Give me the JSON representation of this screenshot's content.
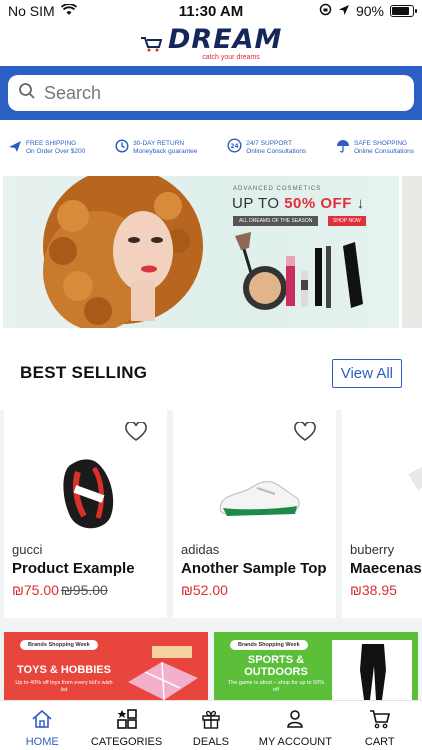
{
  "status": {
    "carrier": "No SIM",
    "time": "11:30 AM",
    "battery": "90%"
  },
  "brand": {
    "name": "DREAM",
    "tagline": "catch your dreams"
  },
  "search": {
    "placeholder": "Search"
  },
  "features": [
    {
      "icon": "plane-icon",
      "title": "FREE SHIPPING",
      "sub": "On Order Over $200"
    },
    {
      "icon": "clock-icon",
      "title": "30-DAY RETURN",
      "sub": "Moneyback guarantee"
    },
    {
      "icon": "support-24-icon",
      "title": "24/7 SUPPORT",
      "sub": "Online Consultations"
    },
    {
      "icon": "umbrella-icon",
      "title": "SAFE SHOPPING",
      "sub": "Online Consultations"
    }
  ],
  "banner": {
    "kicker": "ADVANCED COSMETICS",
    "title_pre": "UP TO",
    "title_highlight": "50% OFF",
    "title_arrow": "↓",
    "pill_left": "ALL DREAMS OF THE SEASON",
    "pill_right": "SHOP NOW"
  },
  "best_selling": {
    "title": "BEST SELLING",
    "view_all": "View All",
    "products": [
      {
        "brand": "gucci",
        "name": "Product Example",
        "price": "₪75.00",
        "old_price": "₪95.00"
      },
      {
        "brand": "adidas",
        "name": "Another Sample Top",
        "price": "₪52.00",
        "old_price": ""
      },
      {
        "brand": "buberry",
        "name": "Maecenas",
        "price": "₪38.95",
        "old_price": ""
      }
    ]
  },
  "promos": [
    {
      "tag": "Brands Shopping Week",
      "head": "TOYS & HOBBIES",
      "desc": "Up to 40% off toys from every kid's wish list"
    },
    {
      "tag": "Brands Shopping Week",
      "head": "SPORTS & OUTDOORS",
      "desc": "The game is afoot – shop for up to 50% off"
    }
  ],
  "tabs": [
    {
      "label": "HOME",
      "icon": "home-icon",
      "active": true
    },
    {
      "label": "CATEGORIES",
      "icon": "categories-icon",
      "active": false
    },
    {
      "label": "DEALS",
      "icon": "gift-icon",
      "active": false
    },
    {
      "label": "MY ACCOUNT",
      "icon": "account-icon",
      "active": false
    },
    {
      "label": "CART",
      "icon": "cart-icon",
      "active": false
    }
  ],
  "colors": {
    "accent": "#2c5fc3",
    "price": "#d93030",
    "brand_navy": "#14265a"
  }
}
